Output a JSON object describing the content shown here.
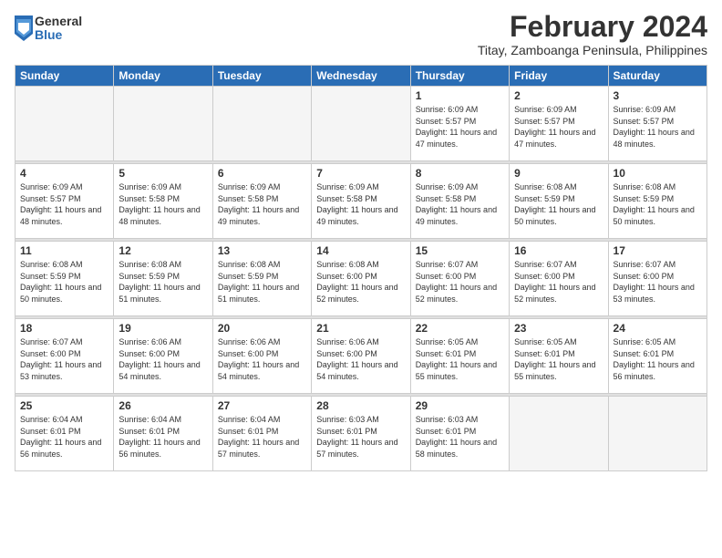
{
  "logo": {
    "general": "General",
    "blue": "Blue"
  },
  "title": {
    "month": "February 2024",
    "location": "Titay, Zamboanga Peninsula, Philippines"
  },
  "headers": [
    "Sunday",
    "Monday",
    "Tuesday",
    "Wednesday",
    "Thursday",
    "Friday",
    "Saturday"
  ],
  "weeks": [
    [
      {
        "day": "",
        "info": ""
      },
      {
        "day": "",
        "info": ""
      },
      {
        "day": "",
        "info": ""
      },
      {
        "day": "",
        "info": ""
      },
      {
        "day": "1",
        "info": "Sunrise: 6:09 AM\nSunset: 5:57 PM\nDaylight: 11 hours\nand 47 minutes."
      },
      {
        "day": "2",
        "info": "Sunrise: 6:09 AM\nSunset: 5:57 PM\nDaylight: 11 hours\nand 47 minutes."
      },
      {
        "day": "3",
        "info": "Sunrise: 6:09 AM\nSunset: 5:57 PM\nDaylight: 11 hours\nand 48 minutes."
      }
    ],
    [
      {
        "day": "4",
        "info": "Sunrise: 6:09 AM\nSunset: 5:57 PM\nDaylight: 11 hours\nand 48 minutes."
      },
      {
        "day": "5",
        "info": "Sunrise: 6:09 AM\nSunset: 5:58 PM\nDaylight: 11 hours\nand 48 minutes."
      },
      {
        "day": "6",
        "info": "Sunrise: 6:09 AM\nSunset: 5:58 PM\nDaylight: 11 hours\nand 49 minutes."
      },
      {
        "day": "7",
        "info": "Sunrise: 6:09 AM\nSunset: 5:58 PM\nDaylight: 11 hours\nand 49 minutes."
      },
      {
        "day": "8",
        "info": "Sunrise: 6:09 AM\nSunset: 5:58 PM\nDaylight: 11 hours\nand 49 minutes."
      },
      {
        "day": "9",
        "info": "Sunrise: 6:08 AM\nSunset: 5:59 PM\nDaylight: 11 hours\nand 50 minutes."
      },
      {
        "day": "10",
        "info": "Sunrise: 6:08 AM\nSunset: 5:59 PM\nDaylight: 11 hours\nand 50 minutes."
      }
    ],
    [
      {
        "day": "11",
        "info": "Sunrise: 6:08 AM\nSunset: 5:59 PM\nDaylight: 11 hours\nand 50 minutes."
      },
      {
        "day": "12",
        "info": "Sunrise: 6:08 AM\nSunset: 5:59 PM\nDaylight: 11 hours\nand 51 minutes."
      },
      {
        "day": "13",
        "info": "Sunrise: 6:08 AM\nSunset: 5:59 PM\nDaylight: 11 hours\nand 51 minutes."
      },
      {
        "day": "14",
        "info": "Sunrise: 6:08 AM\nSunset: 6:00 PM\nDaylight: 11 hours\nand 52 minutes."
      },
      {
        "day": "15",
        "info": "Sunrise: 6:07 AM\nSunset: 6:00 PM\nDaylight: 11 hours\nand 52 minutes."
      },
      {
        "day": "16",
        "info": "Sunrise: 6:07 AM\nSunset: 6:00 PM\nDaylight: 11 hours\nand 52 minutes."
      },
      {
        "day": "17",
        "info": "Sunrise: 6:07 AM\nSunset: 6:00 PM\nDaylight: 11 hours\nand 53 minutes."
      }
    ],
    [
      {
        "day": "18",
        "info": "Sunrise: 6:07 AM\nSunset: 6:00 PM\nDaylight: 11 hours\nand 53 minutes."
      },
      {
        "day": "19",
        "info": "Sunrise: 6:06 AM\nSunset: 6:00 PM\nDaylight: 11 hours\nand 54 minutes."
      },
      {
        "day": "20",
        "info": "Sunrise: 6:06 AM\nSunset: 6:00 PM\nDaylight: 11 hours\nand 54 minutes."
      },
      {
        "day": "21",
        "info": "Sunrise: 6:06 AM\nSunset: 6:00 PM\nDaylight: 11 hours\nand 54 minutes."
      },
      {
        "day": "22",
        "info": "Sunrise: 6:05 AM\nSunset: 6:01 PM\nDaylight: 11 hours\nand 55 minutes."
      },
      {
        "day": "23",
        "info": "Sunrise: 6:05 AM\nSunset: 6:01 PM\nDaylight: 11 hours\nand 55 minutes."
      },
      {
        "day": "24",
        "info": "Sunrise: 6:05 AM\nSunset: 6:01 PM\nDaylight: 11 hours\nand 56 minutes."
      }
    ],
    [
      {
        "day": "25",
        "info": "Sunrise: 6:04 AM\nSunset: 6:01 PM\nDaylight: 11 hours\nand 56 minutes."
      },
      {
        "day": "26",
        "info": "Sunrise: 6:04 AM\nSunset: 6:01 PM\nDaylight: 11 hours\nand 56 minutes."
      },
      {
        "day": "27",
        "info": "Sunrise: 6:04 AM\nSunset: 6:01 PM\nDaylight: 11 hours\nand 57 minutes."
      },
      {
        "day": "28",
        "info": "Sunrise: 6:03 AM\nSunset: 6:01 PM\nDaylight: 11 hours\nand 57 minutes."
      },
      {
        "day": "29",
        "info": "Sunrise: 6:03 AM\nSunset: 6:01 PM\nDaylight: 11 hours\nand 58 minutes."
      },
      {
        "day": "",
        "info": ""
      },
      {
        "day": "",
        "info": ""
      }
    ]
  ]
}
